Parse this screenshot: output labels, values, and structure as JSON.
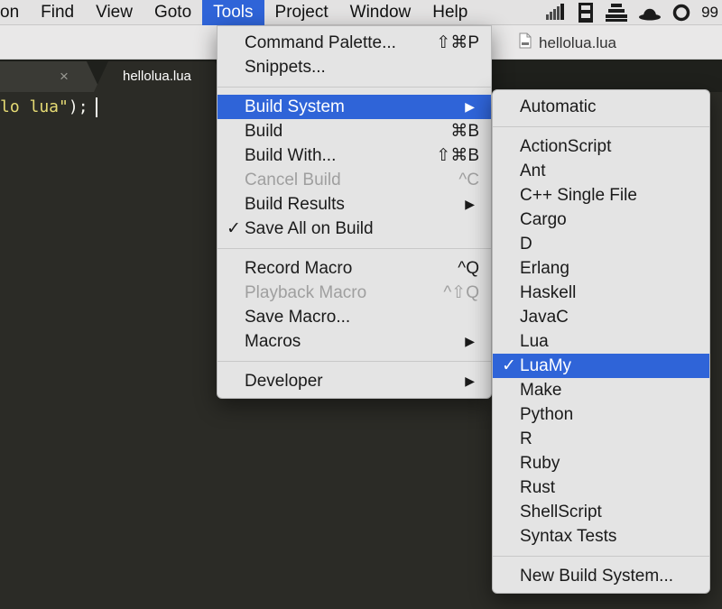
{
  "menubar": {
    "items": [
      "on",
      "Find",
      "View",
      "Goto",
      "Tools",
      "Project",
      "Window",
      "Help"
    ],
    "active": "Tools",
    "clock": "99"
  },
  "window": {
    "title": "hellolua.lua"
  },
  "tabs": [
    {
      "label": "",
      "active": false,
      "close": "×"
    },
    {
      "label": "hellolua.lua",
      "active": true
    }
  ],
  "editor": {
    "code_string": "lo lua\"",
    "code_rest": ");"
  },
  "tools_menu": {
    "groups": [
      [
        {
          "label": "Command Palette...",
          "shortcut": "⇧⌘P"
        },
        {
          "label": "Snippets..."
        }
      ],
      [
        {
          "label": "Build System",
          "submenu": true,
          "highlighted": true
        },
        {
          "label": "Build",
          "shortcut": "⌘B"
        },
        {
          "label": "Build With...",
          "shortcut": "⇧⌘B"
        },
        {
          "label": "Cancel Build",
          "shortcut": "^C",
          "disabled": true
        },
        {
          "label": "Build Results",
          "submenu": true
        },
        {
          "label": "Save All on Build",
          "checked": true
        }
      ],
      [
        {
          "label": "Record Macro",
          "shortcut": "^Q"
        },
        {
          "label": "Playback Macro",
          "shortcut": "^⇧Q",
          "disabled": true
        },
        {
          "label": "Save Macro..."
        },
        {
          "label": "Macros",
          "submenu": true
        }
      ],
      [
        {
          "label": "Developer",
          "submenu": true
        }
      ]
    ]
  },
  "build_system_menu": {
    "groups": [
      [
        {
          "label": "Automatic"
        }
      ],
      [
        {
          "label": "ActionScript"
        },
        {
          "label": "Ant"
        },
        {
          "label": "C++ Single File"
        },
        {
          "label": "Cargo"
        },
        {
          "label": "D"
        },
        {
          "label": "Erlang"
        },
        {
          "label": "Haskell"
        },
        {
          "label": "JavaC"
        },
        {
          "label": "Lua"
        },
        {
          "label": "LuaMy",
          "checked": true,
          "highlighted": true
        },
        {
          "label": "Make"
        },
        {
          "label": "Python"
        },
        {
          "label": "R"
        },
        {
          "label": "Ruby"
        },
        {
          "label": "Rust"
        },
        {
          "label": "ShellScript"
        },
        {
          "label": "Syntax Tests"
        }
      ],
      [
        {
          "label": "New Build System..."
        }
      ]
    ]
  },
  "glyphs": {
    "check": "✓",
    "submenu_arrow": "▶"
  },
  "colors": {
    "highlight": "#2f64d8",
    "editor_bg": "#2b2b26",
    "string": "#e6db74"
  },
  "icons": [
    "striped-status-icon",
    "shelf-status-icon",
    "stack-status-icon",
    "bowler-hat-icon",
    "ring-icon",
    "document-icon"
  ]
}
